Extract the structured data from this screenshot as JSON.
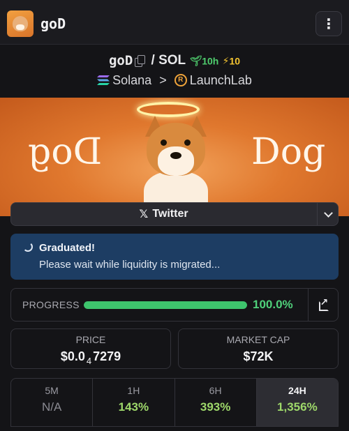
{
  "header": {
    "title": "goD",
    "menu_icon": "vertical-ellipsis-icon"
  },
  "token": {
    "symbol": "goD",
    "separator": "/",
    "quote": "SOL",
    "age": "10h",
    "boosts": "10",
    "chain": "Solana",
    "breadcrumb_sep": ">",
    "dex": "LaunchLab"
  },
  "banner": {
    "left_word": "Dog",
    "right_word": "Dog"
  },
  "social": {
    "twitter_label": "Twitter"
  },
  "alert": {
    "title": "Graduated!",
    "message": "Please wait while liquidity is migrated..."
  },
  "progress": {
    "label": "PROGRESS",
    "value_text": "100.0%",
    "fraction": 1.0
  },
  "stats": {
    "price_label": "PRICE",
    "price_prefix": "$0.0",
    "price_zeros": "4",
    "price_digits": "7279",
    "mcap_label": "MARKET CAP",
    "mcap_value": "$72K"
  },
  "timeframes": [
    {
      "label": "5M",
      "value": "N/A"
    },
    {
      "label": "1H",
      "value": "143%"
    },
    {
      "label": "6H",
      "value": "393%"
    },
    {
      "label": "24H",
      "value": "1,356%"
    }
  ],
  "colors": {
    "positive": "#9ed86a",
    "progress": "#3ec46d",
    "alert_bg": "#1d3d63"
  }
}
